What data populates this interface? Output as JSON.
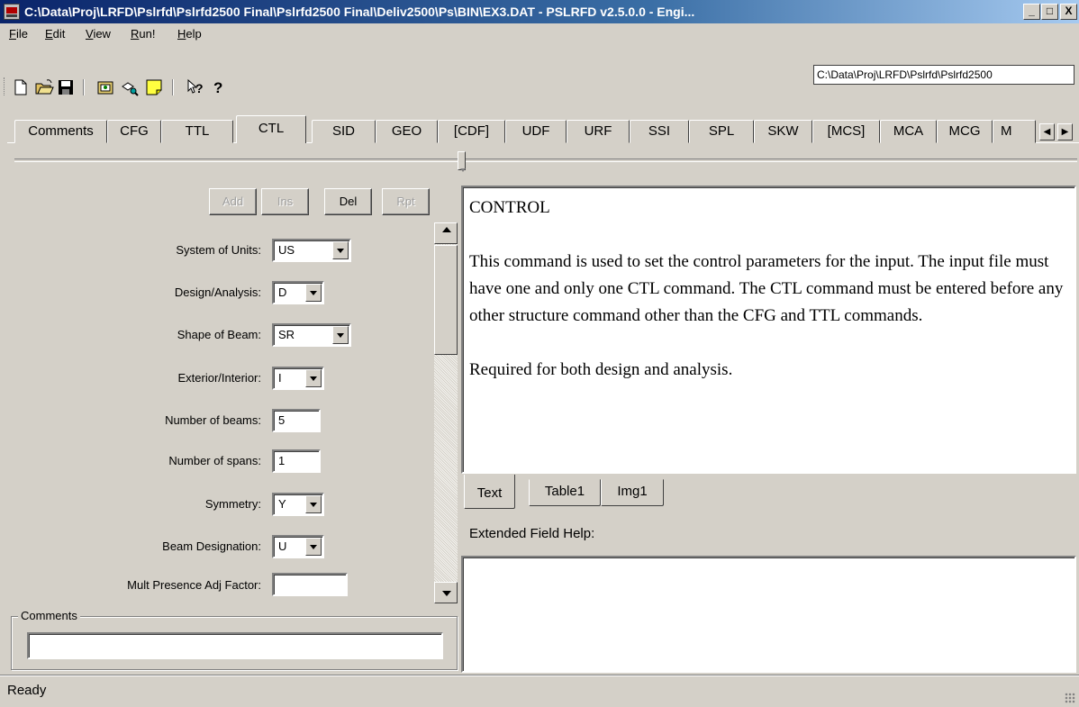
{
  "window": {
    "title": "C:\\Data\\Proj\\LRFD\\Pslrfd\\Pslrfd2500 Final\\Pslrfd2500 Final\\Deliv2500\\Ps\\BIN\\EX3.DAT - PSLRFD v2.5.0.0 - Engi...",
    "minimize_glyph": "_",
    "maximize_glyph": "□",
    "close_glyph": "X"
  },
  "menu": {
    "items": [
      {
        "label": "File",
        "underline": "F",
        "rest": "ile"
      },
      {
        "label": "Edit",
        "underline": "E",
        "rest": "dit"
      },
      {
        "label": "View",
        "underline": "V",
        "rest": "iew"
      },
      {
        "label": "Run!",
        "underline": "R",
        "rest": "un!"
      },
      {
        "label": "Help",
        "underline": "H",
        "rest": "elp"
      }
    ],
    "path_display": "C:\\Data\\Proj\\LRFD\\Pslrfd\\Pslrfd2500"
  },
  "toolbar": {
    "icons": [
      "new-file-icon",
      "open-folder-icon",
      "save-icon",
      "open-dialog-icon",
      "view-icon",
      "note-icon",
      "context-help-icon",
      "help-icon"
    ]
  },
  "tabs": {
    "items": [
      "Comments",
      "CFG",
      "TTL",
      "CTL",
      "SID",
      "GEO",
      "[CDF]",
      "UDF",
      "URF",
      "SSI",
      "SPL",
      "SKW",
      "[MCS]",
      "MCA",
      "MCG",
      "M"
    ],
    "active": "CTL",
    "scroll_left_glyph": "◀",
    "scroll_right_glyph": "▶"
  },
  "commands": {
    "add": "Add",
    "ins": "Ins",
    "del": "Del",
    "rpt": "Rpt"
  },
  "form": {
    "system_of_units": {
      "label": "System of Units:",
      "value": "US"
    },
    "design_analysis": {
      "label": "Design/Analysis:",
      "value": "D"
    },
    "shape_of_beam": {
      "label": "Shape of Beam:",
      "value": "SR"
    },
    "exterior_interior": {
      "label": "Exterior/Interior:",
      "value": "I"
    },
    "number_of_beams": {
      "label": "Number of beams:",
      "value": "5"
    },
    "number_of_spans": {
      "label": "Number of spans:",
      "value": "1"
    },
    "symmetry": {
      "label": "Symmetry:",
      "value": "Y"
    },
    "beam_designation": {
      "label": "Beam Designation:",
      "value": "U"
    },
    "mult_presence": {
      "label": "Mult Presence Adj Factor:",
      "value": ""
    }
  },
  "comments": {
    "label": "Comments",
    "value": ""
  },
  "help": {
    "heading": "CONTROL",
    "paragraph1": "This command is used to set the control parameters for the input. The input file must have one and only one CTL  command.  The CTL command must be entered before any other structure command other than the CFG and TTL commands.",
    "paragraph2": "Required for both design and analysis.",
    "subtabs": [
      "Text",
      "Table1",
      "Img1"
    ],
    "active_subtab": "Text",
    "extended_label": "Extended Field Help:",
    "extended_text": ""
  },
  "status": {
    "text": "Ready"
  }
}
